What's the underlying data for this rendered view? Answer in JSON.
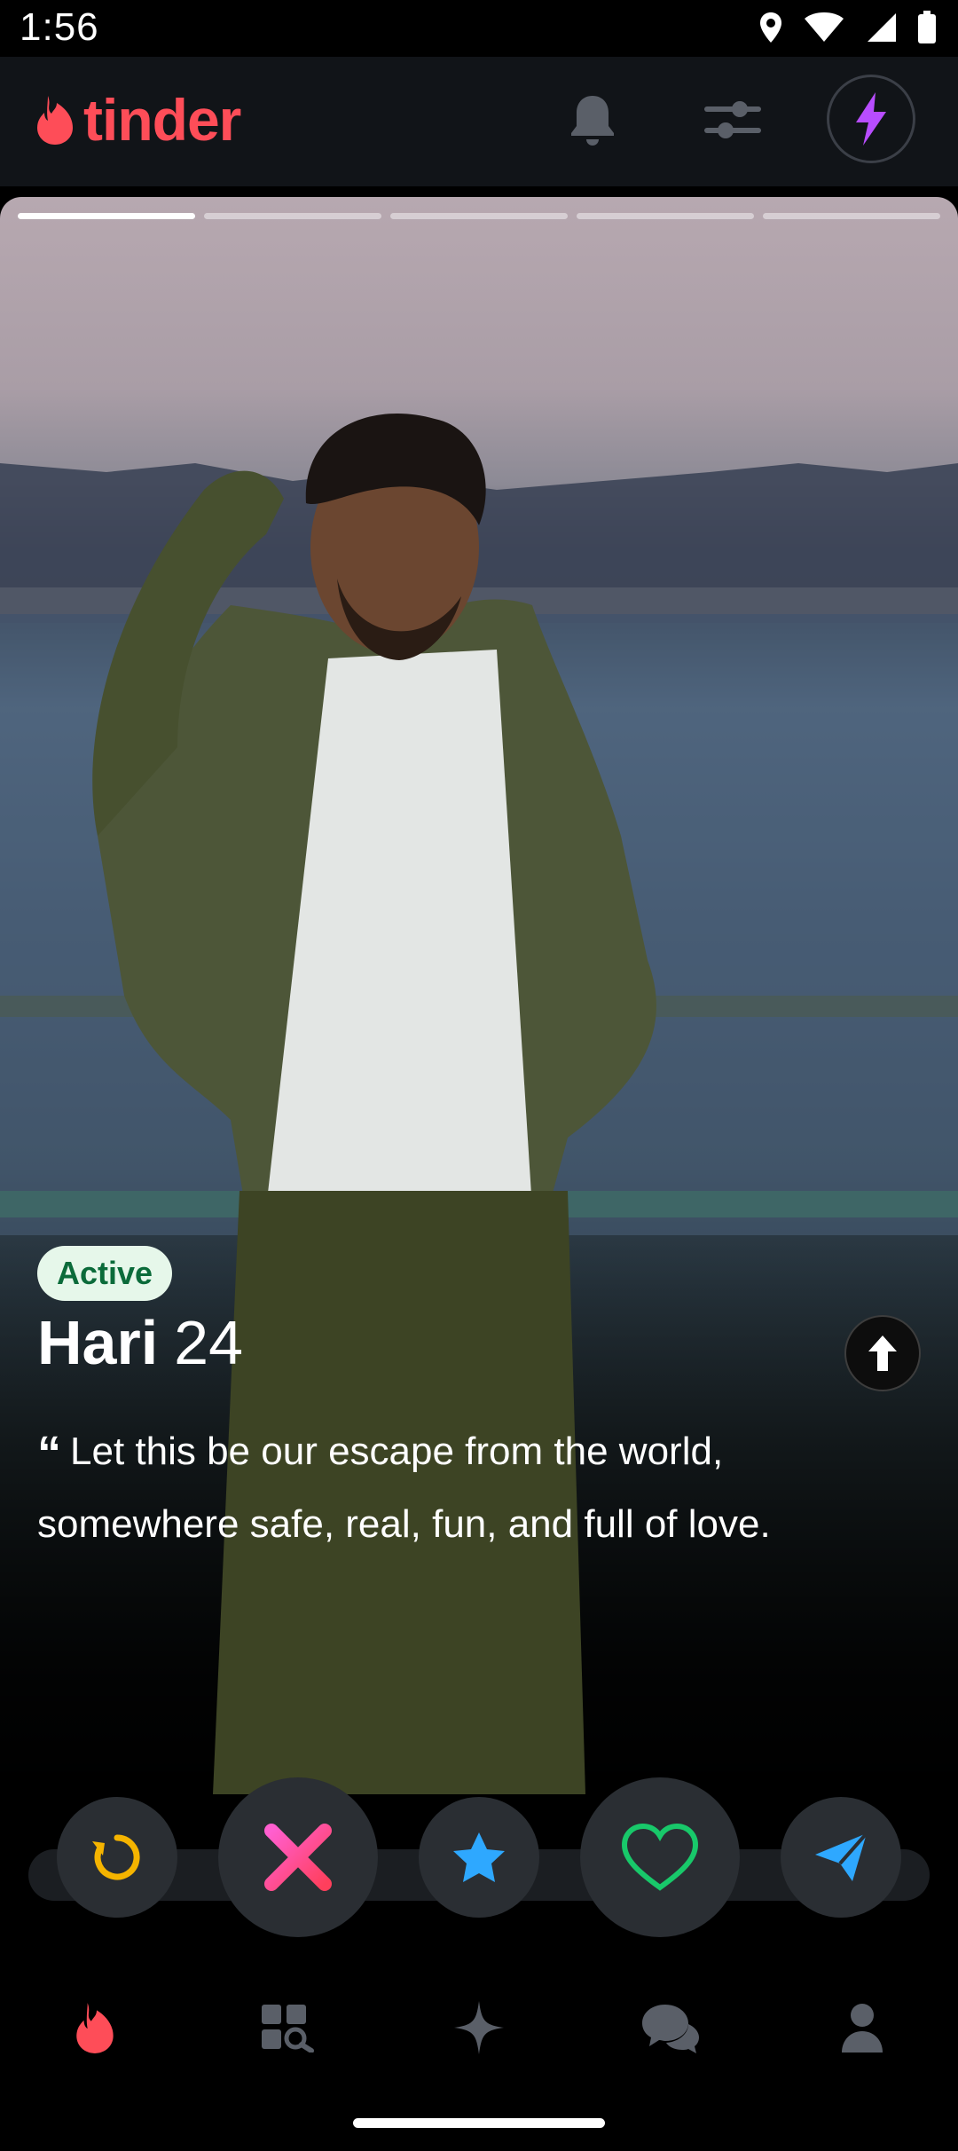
{
  "status_bar": {
    "time": "1:56"
  },
  "app": {
    "name": "tinder"
  },
  "card": {
    "photo_count": 5,
    "active_photo_index": 0,
    "badge": "Active",
    "name": "Hari",
    "age": "24",
    "quote_mark": "“",
    "bio": "Let this be our escape from the world, somewhere safe, real, fun, and full of love."
  },
  "colors": {
    "brand": "#fe4d58",
    "nope": "#ff3f8a",
    "super_like": "#2ea8ff",
    "like": "#18c86a",
    "rewind": "#f5b400",
    "boost": "#b84dff"
  },
  "actions": [
    {
      "icon": "rewind-icon"
    },
    {
      "icon": "nope-icon"
    },
    {
      "icon": "super-like-icon"
    },
    {
      "icon": "like-icon"
    },
    {
      "icon": "boost-send-icon"
    }
  ],
  "nav": [
    {
      "icon": "flame-icon",
      "active": true
    },
    {
      "icon": "explore-icon",
      "active": false
    },
    {
      "icon": "sparkle-icon",
      "active": false
    },
    {
      "icon": "chat-icon",
      "active": false
    },
    {
      "icon": "profile-icon",
      "active": false
    }
  ]
}
